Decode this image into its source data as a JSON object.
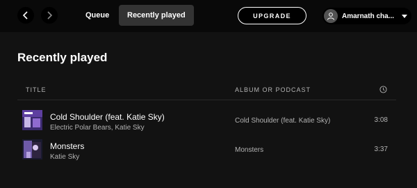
{
  "nav": {
    "back_icon": "chevron-left-icon",
    "forward_icon": "chevron-right-icon"
  },
  "tabs": [
    {
      "label": "Queue",
      "active": false
    },
    {
      "label": "Recently played",
      "active": true
    }
  ],
  "upgrade_label": "UPGRADE",
  "user": {
    "name": "Amarnath cha...",
    "avatar_icon": "user-icon",
    "menu_icon": "caret-down-icon"
  },
  "page_title": "Recently played",
  "columns": {
    "title": "TITLE",
    "album": "ALBUM OR PODCAST",
    "duration_icon": "clock-icon"
  },
  "tracks": [
    {
      "title": "Cold Shoulder (feat. Katie Sky)",
      "artist": "Electric Polar Bears, Katie Sky",
      "album": "Cold Shoulder (feat. Katie Sky)",
      "duration": "3:08"
    },
    {
      "title": "Monsters",
      "artist": "Katie Sky",
      "album": "Monsters",
      "duration": "3:37"
    }
  ],
  "colors": {
    "background": "#121212",
    "topbar": "#090909",
    "active_tab": "#333333",
    "secondary_text": "#b3b3b3"
  }
}
